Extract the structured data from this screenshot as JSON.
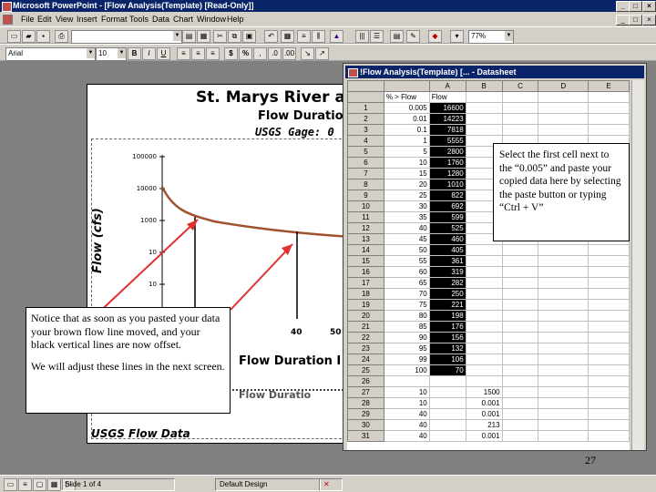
{
  "window": {
    "title": "Microsoft PowerPoint - [Flow Analysis(Template) [Read-Only]]",
    "controls": [
      "_",
      "□",
      "×"
    ]
  },
  "menu": {
    "items": [
      "File",
      "Edit",
      "View",
      "Insert",
      "Format",
      "Tools",
      "Data",
      "Chart",
      "Window",
      "Help"
    ]
  },
  "toolbar": {
    "zoom": "77%",
    "font_name": "Arial",
    "font_size": "10",
    "bold": "B",
    "italic": "I",
    "underline": "U",
    "currency": "$",
    "percent": "%"
  },
  "chart": {
    "title": "St. Marys River at",
    "subtitle": "Flow Duration",
    "gage": "USGS Gage:  0",
    "ylabel": "Flow (cfs)",
    "xlabel": "Flow Duration I",
    "xlabel2": "Flow Duratio",
    "footer": "USGS Flow Data",
    "yticks": [
      "100000",
      "10000",
      "1000",
      "10",
      "10"
    ],
    "xticks": [
      "40",
      "50"
    ]
  },
  "datasheet": {
    "title": "!Flow Analysis(Template) [... - Datasheet",
    "columns": [
      "A",
      "B",
      "C",
      "D",
      "E"
    ],
    "header_row": [
      "% > Flow",
      "Flow"
    ],
    "rows": [
      {
        "n": "1",
        "x": "0.005",
        "a": "16600",
        "b": ""
      },
      {
        "n": "2",
        "x": "0.01",
        "a": "14223",
        "b": ""
      },
      {
        "n": "3",
        "x": "0.1",
        "a": "7818",
        "b": ""
      },
      {
        "n": "4",
        "x": "1",
        "a": "5555",
        "b": ""
      },
      {
        "n": "5",
        "x": "5",
        "a": "2800",
        "b": ""
      },
      {
        "n": "6",
        "x": "10",
        "a": "1760",
        "b": ""
      },
      {
        "n": "7",
        "x": "15",
        "a": "1280",
        "b": ""
      },
      {
        "n": "8",
        "x": "20",
        "a": "1010",
        "b": ""
      },
      {
        "n": "9",
        "x": "25",
        "a": "822",
        "b": ""
      },
      {
        "n": "10",
        "x": "30",
        "a": "692",
        "b": ""
      },
      {
        "n": "11",
        "x": "35",
        "a": "599",
        "b": ""
      },
      {
        "n": "12",
        "x": "40",
        "a": "525",
        "b": ""
      },
      {
        "n": "13",
        "x": "45",
        "a": "460",
        "b": ""
      },
      {
        "n": "14",
        "x": "50",
        "a": "405",
        "b": ""
      },
      {
        "n": "15",
        "x": "55",
        "a": "361",
        "b": ""
      },
      {
        "n": "16",
        "x": "60",
        "a": "319",
        "b": ""
      },
      {
        "n": "17",
        "x": "65",
        "a": "282",
        "b": ""
      },
      {
        "n": "18",
        "x": "70",
        "a": "250",
        "b": ""
      },
      {
        "n": "19",
        "x": "75",
        "a": "221",
        "b": ""
      },
      {
        "n": "20",
        "x": "80",
        "a": "198",
        "b": ""
      },
      {
        "n": "21",
        "x": "85",
        "a": "176",
        "b": ""
      },
      {
        "n": "22",
        "x": "90",
        "a": "156",
        "b": ""
      },
      {
        "n": "23",
        "x": "95",
        "a": "132",
        "b": ""
      },
      {
        "n": "24",
        "x": "99",
        "a": "106",
        "b": ""
      },
      {
        "n": "25",
        "x": "100",
        "a": "70",
        "b": ""
      },
      {
        "n": "26",
        "x": "",
        "a": "",
        "b": ""
      },
      {
        "n": "27",
        "x": "10",
        "a": "",
        "b": "1500"
      },
      {
        "n": "28",
        "x": "10",
        "a": "",
        "b": "0.001"
      },
      {
        "n": "29",
        "x": "40",
        "a": "",
        "b": "0.001"
      },
      {
        "n": "30",
        "x": "40",
        "a": "",
        "b": "213"
      },
      {
        "n": "31",
        "x": "40",
        "a": "",
        "b": "0.001"
      }
    ]
  },
  "callouts": {
    "right": "Select the first cell next to the “0.005” and paste your copied data here by selecting the paste button or typing “Ctrl + V”",
    "left_p1": "Notice that as  soon as you pasted your data your brown flow line moved, and your black vertical lines are now offset.",
    "left_p2": "We will adjust these lines in the next screen."
  },
  "slide_number": "27",
  "status": {
    "slide": "Slide 1 of 4",
    "design": "Default Design"
  },
  "colors": {
    "titlebar": "#0a246a",
    "flow_line": "#a0522d",
    "arrow": "#e03030"
  }
}
